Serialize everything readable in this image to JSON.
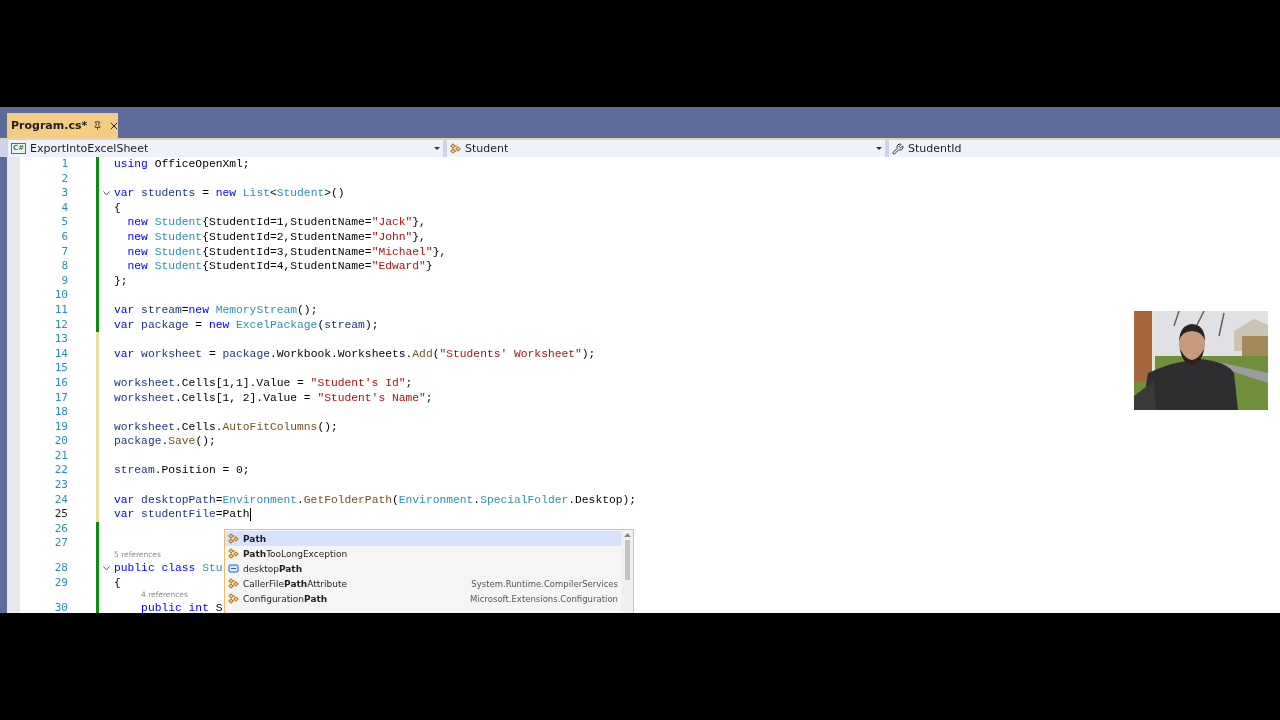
{
  "tab": {
    "label": "Program.cs*",
    "selected": true
  },
  "nav": [
    {
      "kind": "file",
      "icon_text": "C#",
      "label": "ExportIntoExcelSheet"
    },
    {
      "kind": "class",
      "label": "Student"
    },
    {
      "kind": "member",
      "label": "StudentId"
    }
  ],
  "lines": [
    {
      "kind": "code",
      "number": "1",
      "saved": true,
      "tokens": [
        {
          "kind": "kw",
          "text": "using"
        },
        {
          "kind": "plain",
          "text": " OfficeOpenXml;"
        }
      ]
    },
    {
      "kind": "code",
      "number": "2",
      "saved": true
    },
    {
      "kind": "code",
      "number": "3",
      "saved": true,
      "expanded": true,
      "tokens": [
        {
          "kind": "kw",
          "text": "var"
        },
        {
          "kind": "local",
          "text": " students"
        },
        {
          "kind": "plain",
          "text": " = "
        },
        {
          "kind": "kw",
          "text": "new"
        },
        {
          "kind": "type",
          "text": " List"
        },
        {
          "kind": "plain",
          "text": "<"
        },
        {
          "kind": "type",
          "text": "Student"
        },
        {
          "kind": "plain",
          "text": ">()"
        }
      ]
    },
    {
      "kind": "code",
      "number": "4",
      "saved": true,
      "tokens": [
        {
          "kind": "plain",
          "text": "{"
        }
      ]
    },
    {
      "kind": "code",
      "number": "5",
      "saved": true,
      "tokens": [
        {
          "kind": "kw",
          "text": "  new"
        },
        {
          "kind": "type",
          "text": " Student"
        },
        {
          "kind": "plain",
          "text": "{StudentId=1,StudentName="
        },
        {
          "kind": "str",
          "text": "\"Jack\""
        },
        {
          "kind": "plain",
          "text": "},"
        }
      ]
    },
    {
      "kind": "code",
      "number": "6",
      "saved": true,
      "tokens": [
        {
          "kind": "kw",
          "text": "  new"
        },
        {
          "kind": "type",
          "text": " Student"
        },
        {
          "kind": "plain",
          "text": "{StudentId=2,StudentName="
        },
        {
          "kind": "str",
          "text": "\"John\""
        },
        {
          "kind": "plain",
          "text": "},"
        }
      ]
    },
    {
      "kind": "code",
      "number": "7",
      "saved": true,
      "tokens": [
        {
          "kind": "kw",
          "text": "  new"
        },
        {
          "kind": "type",
          "text": " Student"
        },
        {
          "kind": "plain",
          "text": "{StudentId=3,StudentName="
        },
        {
          "kind": "str",
          "text": "\"Michael\""
        },
        {
          "kind": "plain",
          "text": "},"
        }
      ]
    },
    {
      "kind": "code",
      "number": "8",
      "saved": true,
      "tokens": [
        {
          "kind": "kw",
          "text": "  new"
        },
        {
          "kind": "type",
          "text": " Student"
        },
        {
          "kind": "plain",
          "text": "{StudentId=4,StudentName="
        },
        {
          "kind": "str",
          "text": "\"Edward\""
        },
        {
          "kind": "plain",
          "text": "}"
        }
      ]
    },
    {
      "kind": "code",
      "number": "9",
      "saved": true,
      "tokens": [
        {
          "kind": "plain",
          "text": "};"
        }
      ]
    },
    {
      "kind": "code",
      "number": "10",
      "saved": true
    },
    {
      "kind": "code",
      "number": "11",
      "saved": true,
      "tokens": [
        {
          "kind": "kw",
          "text": "var"
        },
        {
          "kind": "local",
          "text": " stream"
        },
        {
          "kind": "plain",
          "text": "="
        },
        {
          "kind": "kw",
          "text": "new"
        },
        {
          "kind": "type",
          "text": " MemoryStream"
        },
        {
          "kind": "plain",
          "text": "();"
        }
      ]
    },
    {
      "kind": "code",
      "number": "12",
      "saved": true,
      "tokens": [
        {
          "kind": "kw",
          "text": "var"
        },
        {
          "kind": "local",
          "text": " package"
        },
        {
          "kind": "plain",
          "text": " = "
        },
        {
          "kind": "kw",
          "text": "new"
        },
        {
          "kind": "type",
          "text": " ExcelPackage"
        },
        {
          "kind": "plain",
          "text": "("
        },
        {
          "kind": "local",
          "text": "stream"
        },
        {
          "kind": "plain",
          "text": ");"
        }
      ]
    },
    {
      "kind": "code",
      "number": "13",
      "saved": false
    },
    {
      "kind": "code",
      "number": "14",
      "saved": false,
      "tokens": [
        {
          "kind": "kw",
          "text": "var"
        },
        {
          "kind": "local",
          "text": " worksheet"
        },
        {
          "kind": "plain",
          "text": " = "
        },
        {
          "kind": "local",
          "text": "package"
        },
        {
          "kind": "plain",
          "text": ".Workbook.Worksheets."
        },
        {
          "kind": "method",
          "text": "Add"
        },
        {
          "kind": "plain",
          "text": "("
        },
        {
          "kind": "str",
          "text": "\"Students' Worksheet\""
        },
        {
          "kind": "plain",
          "text": ");"
        }
      ]
    },
    {
      "kind": "code",
      "number": "15",
      "saved": false
    },
    {
      "kind": "code",
      "number": "16",
      "saved": false,
      "tokens": [
        {
          "kind": "local",
          "text": "worksheet"
        },
        {
          "kind": "plain",
          "text": ".Cells[1,1].Value = "
        },
        {
          "kind": "str",
          "text": "\"Student's Id\""
        },
        {
          "kind": "plain",
          "text": ";"
        }
      ]
    },
    {
      "kind": "code",
      "number": "17",
      "saved": false,
      "tokens": [
        {
          "kind": "local",
          "text": "worksheet"
        },
        {
          "kind": "plain",
          "text": ".Cells[1, 2].Value = "
        },
        {
          "kind": "str",
          "text": "\"Student's Name\""
        },
        {
          "kind": "plain",
          "text": ";"
        }
      ]
    },
    {
      "kind": "code",
      "number": "18",
      "saved": false
    },
    {
      "kind": "code",
      "number": "19",
      "saved": false,
      "tokens": [
        {
          "kind": "local",
          "text": "worksheet"
        },
        {
          "kind": "plain",
          "text": ".Cells."
        },
        {
          "kind": "method",
          "text": "AutoFitColumns"
        },
        {
          "kind": "plain",
          "text": "();"
        }
      ]
    },
    {
      "kind": "code",
      "number": "20",
      "saved": false,
      "tokens": [
        {
          "kind": "local",
          "text": "package"
        },
        {
          "kind": "plain",
          "text": "."
        },
        {
          "kind": "method",
          "text": "Save"
        },
        {
          "kind": "plain",
          "text": "();"
        }
      ]
    },
    {
      "kind": "code",
      "number": "21",
      "saved": false
    },
    {
      "kind": "code",
      "number": "22",
      "saved": false,
      "tokens": [
        {
          "kind": "local",
          "text": "stream"
        },
        {
          "kind": "plain",
          "text": ".Position = 0;"
        }
      ]
    },
    {
      "kind": "code",
      "number": "23",
      "saved": false
    },
    {
      "kind": "code",
      "number": "24",
      "saved": false,
      "tokens": [
        {
          "kind": "kw",
          "text": "var"
        },
        {
          "kind": "local",
          "text": " desktopPath"
        },
        {
          "kind": "plain",
          "text": "="
        },
        {
          "kind": "type",
          "text": "Environment"
        },
        {
          "kind": "plain",
          "text": "."
        },
        {
          "kind": "method",
          "text": "GetFolderPath"
        },
        {
          "kind": "plain",
          "text": "("
        },
        {
          "kind": "type",
          "text": "Environment"
        },
        {
          "kind": "plain",
          "text": "."
        },
        {
          "kind": "type",
          "text": "SpecialFolder"
        },
        {
          "kind": "plain",
          "text": ".Desktop);"
        }
      ]
    },
    {
      "kind": "code",
      "number": "25",
      "saved": false,
      "caret": true,
      "tokens": [
        {
          "kind": "kw",
          "text": "var"
        },
        {
          "kind": "local",
          "text": " studentFile"
        },
        {
          "kind": "plain",
          "text": "=Path"
        }
      ]
    },
    {
      "kind": "code",
      "number": "26",
      "saved": true
    },
    {
      "kind": "code",
      "number": "27",
      "saved": true
    },
    {
      "kind": "lens",
      "saved": true,
      "text": "5 references"
    },
    {
      "kind": "code",
      "number": "28",
      "saved": true,
      "expanded": true,
      "tokens": [
        {
          "kind": "kw",
          "text": "public class"
        },
        {
          "kind": "type",
          "text": " Stu"
        }
      ]
    },
    {
      "kind": "code",
      "number": "29",
      "saved": true,
      "tokens": [
        {
          "kind": "plain",
          "text": "{"
        }
      ]
    },
    {
      "kind": "lens",
      "saved": true,
      "indent": true,
      "text": "4 references"
    },
    {
      "kind": "code",
      "number": "30",
      "saved": true,
      "tokens": [
        {
          "kind": "kw",
          "text": "    public int"
        },
        {
          "kind": "plain",
          "text": " S"
        }
      ]
    }
  ],
  "completion": [
    {
      "kind": "class",
      "name": "**Path**",
      "selected": true
    },
    {
      "kind": "class",
      "name": "**Path**TooLongException",
      "selected": false
    },
    {
      "kind": "local",
      "name": "desktop**Path**",
      "selected": false
    },
    {
      "kind": "class",
      "name": "CallerFile**Path**Attribute",
      "namespace": "System.Runtime.CompilerServices",
      "selected": false
    },
    {
      "kind": "class",
      "name": "Configuration**Path**",
      "namespace": "Microsoft.Extensions.Configuration",
      "selected": false
    }
  ]
}
